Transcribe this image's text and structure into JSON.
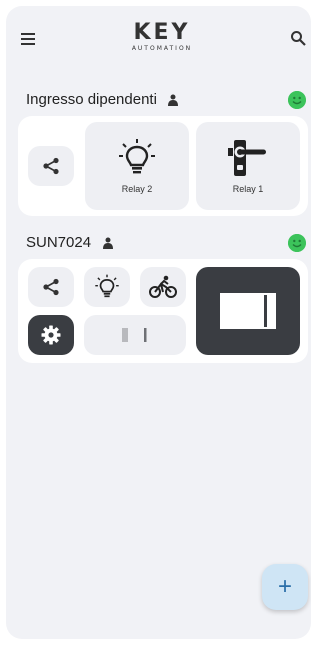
{
  "app": {
    "logo_main": "KEY",
    "logo_sub": "AUTOMATION"
  },
  "groups": [
    {
      "title": "Ingresso dipendenti",
      "status": "online",
      "status_color": "#3cc35b",
      "tiles": [
        {
          "icon": "share-icon"
        },
        {
          "icon": "light-bulb-icon",
          "label": "Relay 2"
        },
        {
          "icon": "door-handle-icon",
          "label": "Relay 1"
        }
      ]
    },
    {
      "title": "SUN7024",
      "status": "online",
      "status_color": "#3cc35b",
      "tiles": [
        {
          "icon": "share-icon"
        },
        {
          "icon": "light-bulb-icon"
        },
        {
          "icon": "cyclist-icon"
        },
        {
          "icon": "gate-icon"
        },
        {
          "icon": "settings-icon"
        },
        {
          "icon": "gate-open-icon"
        }
      ]
    }
  ],
  "fab": {
    "label": "+"
  }
}
